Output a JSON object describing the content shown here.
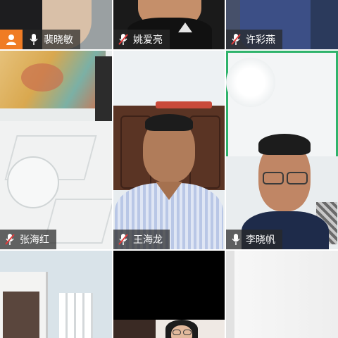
{
  "participants": [
    {
      "name": "",
      "mic": "none"
    },
    {
      "name": "",
      "mic": "none"
    },
    {
      "name": "",
      "mic": "none"
    },
    {
      "name": "裴晓敏",
      "mic": "on",
      "avatar": true
    },
    {
      "name": "姚爱亮",
      "mic": "muted"
    },
    {
      "name": "许彩燕",
      "mic": "muted"
    },
    {
      "name": "张海红",
      "mic": "muted"
    },
    {
      "name": "王海龙",
      "mic": "muted"
    },
    {
      "name": "李晓帆",
      "mic": "on",
      "active": true
    },
    {
      "name": "",
      "mic": "none"
    },
    {
      "name": "",
      "mic": "none"
    },
    {
      "name": "",
      "mic": "none"
    }
  ],
  "colors": {
    "active_border": "#2fb36b",
    "avatar_badge": "#f07c24",
    "namebar_bg": "rgba(40,40,40,0.72)"
  },
  "icons": {
    "mic_on": "microphone-icon",
    "mic_muted": "microphone-muted-icon",
    "avatar": "user-avatar-icon"
  }
}
